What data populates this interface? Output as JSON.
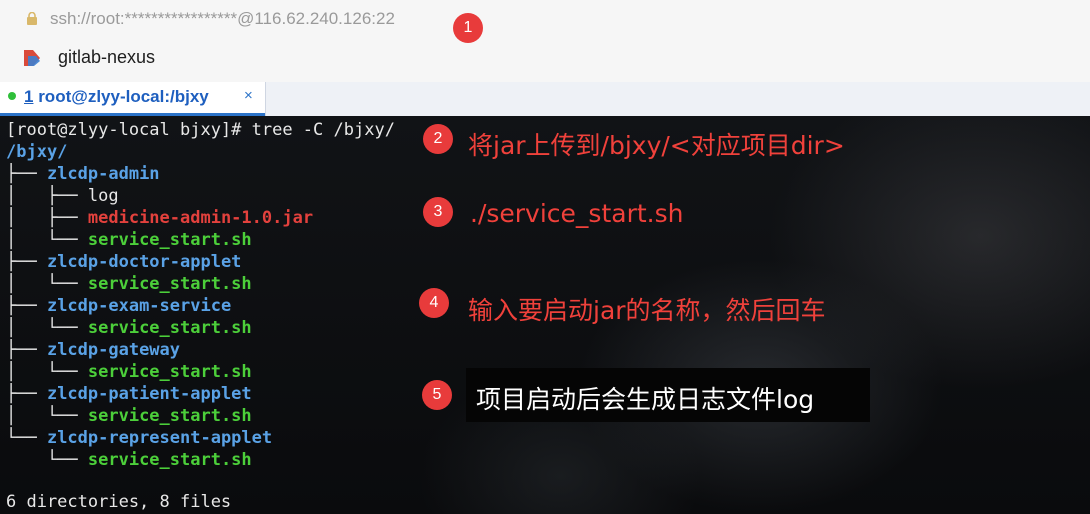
{
  "address_bar": {
    "url": "ssh://root:*****************@116.62.240.126:22",
    "lock_icon": "lock-icon"
  },
  "bookmark_bar": {
    "session_label": "gitlab-nexus",
    "session_icon": "session-flag-icon"
  },
  "tab": {
    "number": "1",
    "title": " root@zlyy-local:/bjxy",
    "close_symbol": "×"
  },
  "terminal": {
    "prompt_command": "[root@zlyy-local bjxy]# tree -C /bjxy/",
    "root_dir": "/bjxy/",
    "tree": [
      {
        "prefix": "├── ",
        "name": "zlcdp-admin",
        "kind": "dir"
      },
      {
        "prefix": "│   ├── ",
        "name": "log",
        "kind": "plain"
      },
      {
        "prefix": "│   ├── ",
        "name": "medicine-admin-1.0.jar",
        "kind": "jar"
      },
      {
        "prefix": "│   └── ",
        "name": "service_start.sh",
        "kind": "sh"
      },
      {
        "prefix": "├── ",
        "name": "zlcdp-doctor-applet",
        "kind": "dir"
      },
      {
        "prefix": "│   └── ",
        "name": "service_start.sh",
        "kind": "sh"
      },
      {
        "prefix": "├── ",
        "name": "zlcdp-exam-service",
        "kind": "dir"
      },
      {
        "prefix": "│   └── ",
        "name": "service_start.sh",
        "kind": "sh"
      },
      {
        "prefix": "├── ",
        "name": "zlcdp-gateway",
        "kind": "dir"
      },
      {
        "prefix": "│   └── ",
        "name": "service_start.sh",
        "kind": "sh"
      },
      {
        "prefix": "├── ",
        "name": "zlcdp-patient-applet",
        "kind": "dir"
      },
      {
        "prefix": "│   └── ",
        "name": "service_start.sh",
        "kind": "sh"
      },
      {
        "prefix": "└── ",
        "name": "zlcdp-represent-applet",
        "kind": "dir"
      },
      {
        "prefix": "    └── ",
        "name": "service_start.sh",
        "kind": "sh"
      }
    ],
    "summary": "6 directories, 8 files"
  },
  "annotations": [
    {
      "num": "1",
      "text": ""
    },
    {
      "num": "2",
      "text": "将jar上传到/bjxy/<对应项目dir>"
    },
    {
      "num": "3",
      "text": "./service_start.sh"
    },
    {
      "num": "4",
      "text": "输入要启动jar的名称，然后回车"
    },
    {
      "num": "5",
      "text": "项目启动后会生成日志文件log"
    }
  ],
  "colors": {
    "dir": "#5aa2e6",
    "sh": "#4ccf3a",
    "jar": "#e3413d",
    "annotation": "#f0413b",
    "badge": "#e83b3b"
  }
}
